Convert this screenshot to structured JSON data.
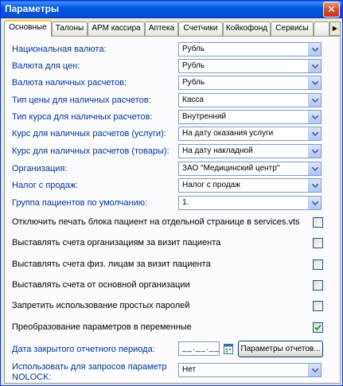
{
  "window": {
    "title": "Параметры"
  },
  "tabs": [
    "Основные",
    "Талоны",
    "АРМ кассира",
    "Аптека",
    "Счетчики",
    "Койкофонд",
    "Сервисы"
  ],
  "fields": [
    {
      "label": "Национальная валюта:",
      "value": "Рубль"
    },
    {
      "label": "Валюта для цен:",
      "value": "Рубль"
    },
    {
      "label": "Валюта наличных расчетов:",
      "value": "Рубль"
    },
    {
      "label": "Тип цены для наличных расчетов:",
      "value": "Касса"
    },
    {
      "label": "Тип курса для наличных расчетов:",
      "value": "Внутренний"
    },
    {
      "label": "Курс для наличных расчетов (услуги):",
      "value": "На дату оказания услуги"
    },
    {
      "label": "Курс для наличных расчетов (товары):",
      "value": "На дату накладной"
    },
    {
      "label": "Организация:",
      "value": "ЗАО \"Медицинский центр\""
    },
    {
      "label": "Налог с продаж:",
      "value": "Налог с продаж"
    },
    {
      "label": "Группа пациентов по умолчанию:",
      "value": "1."
    }
  ],
  "checkboxes": [
    {
      "label": "Отключить печать блока пациент на отдельной странице в services.vts",
      "checked": false
    },
    {
      "label": "Выставлять счета организациям за визит пациента",
      "checked": false
    },
    {
      "label": "Выставлять счета физ. лицам за визит пациента",
      "checked": false
    },
    {
      "label": "Выставлять счета от основной организации",
      "checked": false
    },
    {
      "label": "Запретить использование простых паролей",
      "checked": false
    },
    {
      "label": "Преобразование параметров в переменные",
      "checked": true
    }
  ],
  "closed_period": {
    "label": "Дата закрытого отчетного периода:",
    "date_value": "__.__.__",
    "button_label": "Параметры отчетов..."
  },
  "nolock": {
    "label": "Использовать для запросов параметр NOLOCK:",
    "value": "Нет"
  },
  "icons": {
    "close": "close-icon",
    "dropdown": "chevron-down-icon",
    "calendar": "calendar-icon",
    "checkmark": "checkmark-icon",
    "tab_scroll": "tab-scroll-icon"
  },
  "colors": {
    "label_blue": "#003399",
    "title_blue": "#0058e3",
    "check_green": "#21a121"
  }
}
